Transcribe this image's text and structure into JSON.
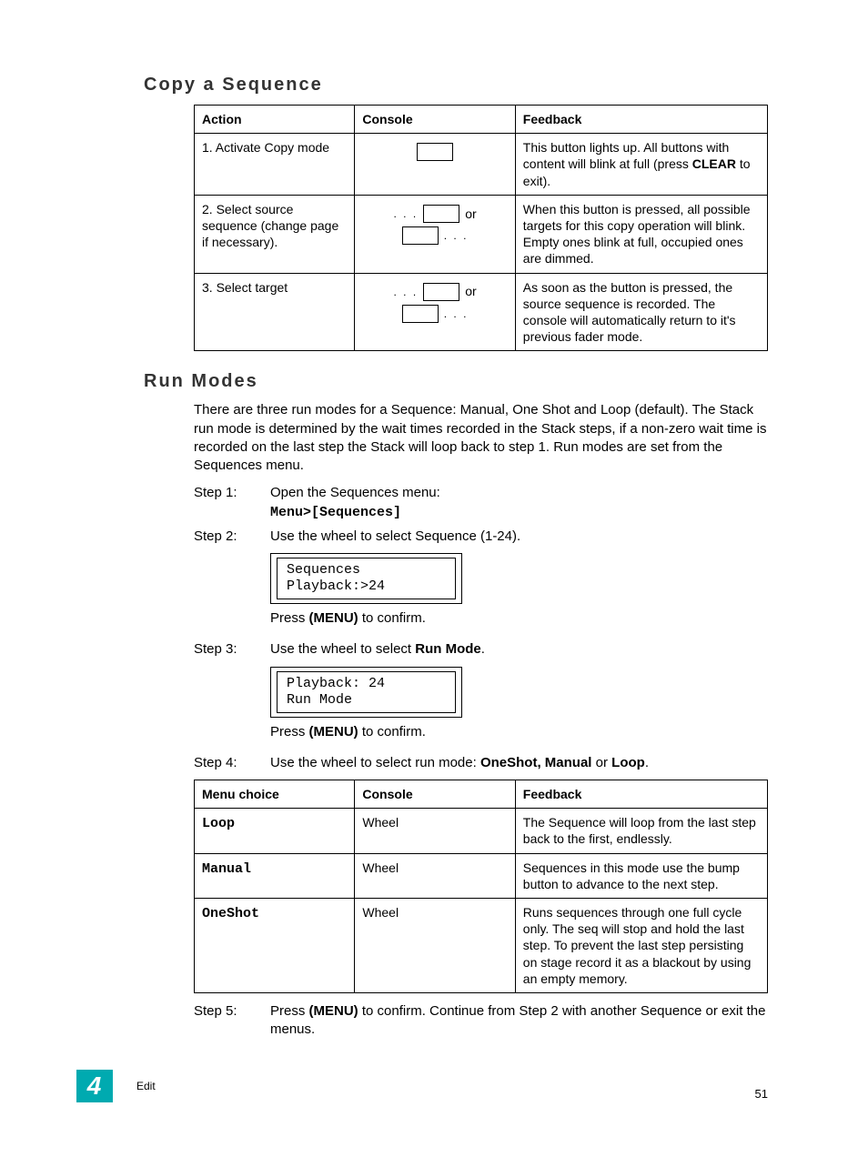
{
  "headings": {
    "copy_a_sequence": "Copy a Sequence",
    "run_modes": "Run Modes"
  },
  "copy_table": {
    "headers": {
      "action": "Action",
      "console": "Console",
      "feedback": "Feedback"
    },
    "rows": [
      {
        "action": "1. Activate Copy mode",
        "console_type": "single",
        "feedback_pre": "This button lights up. All buttons with content will blink at full (press ",
        "feedback_bold": "CLEAR",
        "feedback_post": " to exit)."
      },
      {
        "action": "2. Select source sequence (change page if necessary).",
        "console_type": "double_or",
        "feedback": "When this button is pressed, all possible targets for this copy operation will blink. Empty ones blink at full, occupied ones are dimmed."
      },
      {
        "action": "3. Select target",
        "console_type": "double_or",
        "feedback": "As soon as the button is pressed, the source sequence is recorded. The console will automatically return to it's previous fader mode."
      }
    ],
    "or_label": "or"
  },
  "run_modes_intro": "There are three run modes for a Sequence: Manual, One Shot and Loop (default). The Stack run mode is determined by the wait times recorded in the Stack steps, if a non-zero wait time is recorded on the last step the Stack will loop back to step 1. Run modes are set from the Sequences menu.",
  "steps": {
    "s1": {
      "label": "Step 1:",
      "text": "Open the Sequences menu:",
      "menu_path": "Menu>[Sequences]"
    },
    "s2": {
      "label": "Step 2:",
      "text": "Use the wheel to select Sequence (1-24).",
      "lcd": "Sequences\nPlayback:>24",
      "press_pre": "Press ",
      "press_bold": "(MENU)",
      "press_post": " to confirm."
    },
    "s3": {
      "label": "Step 3:",
      "text_pre": "Use the wheel to select ",
      "text_bold": "Run Mode",
      "text_post": ".",
      "lcd": "Playback: 24\nRun Mode",
      "press_pre": "Press ",
      "press_bold": "(MENU)",
      "press_post": " to confirm."
    },
    "s4": {
      "label": "Step 4:",
      "text_pre": "Use the wheel to select run mode: ",
      "text_bold": "OneShot, Manual",
      "text_mid": " or ",
      "text_bold2": "Loop",
      "text_post": "."
    },
    "s5": {
      "label": "Step 5:",
      "text_pre": "Press ",
      "text_bold": "(MENU)",
      "text_post": " to confirm. Continue from Step 2 with another Sequence or exit the menus."
    }
  },
  "menu_table": {
    "headers": {
      "menu_choice": "Menu choice",
      "console": "Console",
      "feedback": "Feedback"
    },
    "rows": [
      {
        "choice": "Loop",
        "console": "Wheel",
        "feedback": "The Sequence will loop from the last step back to the first, endlessly."
      },
      {
        "choice": "Manual",
        "console": "Wheel",
        "feedback": "Sequences in this mode use the bump button to advance to the next step."
      },
      {
        "choice": "OneShot",
        "console": "Wheel",
        "feedback": "Runs sequences through one full cycle only. The seq will stop and hold the last step. To prevent the last step persisting on stage record it as a blackout by using an empty memory."
      }
    ]
  },
  "footer": {
    "chapter_num": "4",
    "chapter_label": "Edit",
    "page_num": "51"
  }
}
